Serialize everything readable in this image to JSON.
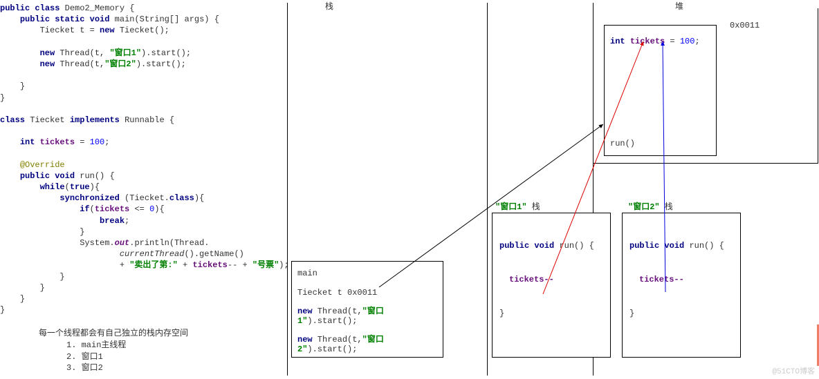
{
  "code": {
    "l1a": "public",
    "l1b": "class",
    "l1c": "Demo2_Memory {",
    "l2a": "public",
    "l2b": "static",
    "l2c": "void",
    "l2d": "main(String[] args) {",
    "l3a": "Tiecket t = ",
    "l3b": "new",
    "l3c": " Tiecket();",
    "l5a": "new",
    "l5b": " Thread(t, ",
    "l5c": "\"窗口1\"",
    "l5d": ").start();",
    "l6a": "new",
    "l6b": " Thread(t,",
    "l6c": "\"窗口2\"",
    "l6d": ").start();",
    "brace_close": "}",
    "l10a": "class",
    "l10b": "Tiecket",
    "l10c": "implements",
    "l10d": "Runnable {",
    "l12a": "int",
    "l12b": "tickets",
    "l12c": " = ",
    "l12d": "100",
    "l12e": ";",
    "l14": "@Override",
    "l15a": "public",
    "l15b": "void",
    "l15c": "run() {",
    "l16a": "while",
    "l16b": "(",
    "l16c": "true",
    "l16d": "){",
    "l17a": "synchronized",
    "l17b": " (Tiecket.",
    "l17c": "class",
    "l17d": "){",
    "l18a": "if",
    "l18b": "(",
    "l18c": "tickets",
    "l18d": " <= ",
    "l18e": "0",
    "l18f": "){",
    "l19a": "break",
    "l19b": ";",
    "l21a": "System.",
    "l21b": "out",
    "l21c": ".println(Thread.",
    "l22a": "currentThread",
    "l22b": "().getName()",
    "l23a": "+ ",
    "l23b": "\"卖出了第:\"",
    "l23c": " + ",
    "l23d": "tickets",
    "l23e": "-- + ",
    "l23f": "\"号票\"",
    "l23g": ");"
  },
  "notes": {
    "n1": "每一个线程都会有自己独立的栈内存空间",
    "n2": "1. main主线程",
    "n3": "2. 窗口1",
    "n4": "3. 窗口2"
  },
  "stack": {
    "header": "栈",
    "main_label": "main",
    "main_l1": "Tiecket t   0x0011",
    "main_l2a": "new",
    "main_l2b": " Thread(t,",
    "main_l2c": "\"窗口1\"",
    "main_l2d": ").start();",
    "main_l3a": "new",
    "main_l3b": " Thread(t,",
    "main_l3c": "\"窗口2\"",
    "main_l3d": ").start();",
    "w1_label": "\"窗口1\"",
    "w1_suffix": " 栈",
    "w2_label": "\"窗口2\"",
    "w2_suffix": " 栈",
    "run_sig_a": "public",
    "run_sig_b": "void",
    "run_sig_c": "run() {",
    "tickets_dec": "tickets--"
  },
  "heap": {
    "header": "堆",
    "addr": "0x0011",
    "int_kw": "int",
    "tickets": "tickets",
    "eq": " = ",
    "val": "100",
    "semi": ";",
    "run": "run()"
  },
  "watermark": "@51CTO博客"
}
